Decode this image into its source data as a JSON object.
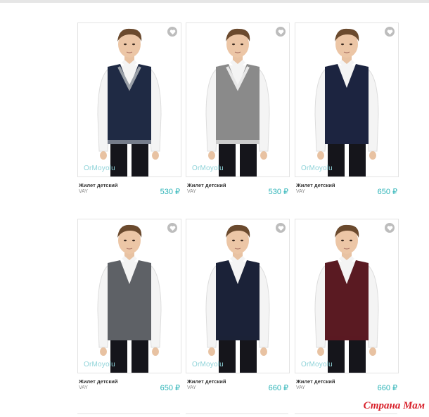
{
  "products": [
    {
      "name": "Жилет детский",
      "brand": "VAY",
      "price": "530 ₽",
      "watermark": "OrMoyolu",
      "vest_color": "#1f2a44",
      "trim_color": "#9aa0a8",
      "vneck_trim": true,
      "shirt": "#f4f4f4"
    },
    {
      "name": "Жилет детский",
      "brand": "VAY",
      "price": "530 ₽",
      "watermark": "OrMoyolu",
      "vest_color": "#8a8a8a",
      "trim_color": "#e8e8e8",
      "vneck_trim": true,
      "shirt": "#f4f4f4"
    },
    {
      "name": "Жилет детский",
      "brand": "VAY",
      "price": "650 ₽",
      "watermark": "OrMoyolu",
      "vest_color": "#1c2440",
      "trim_color": "#1c2440",
      "vneck_trim": false,
      "shirt": "#f4f4f4"
    },
    {
      "name": "Жилет детский",
      "brand": "VAY",
      "price": "650 ₽",
      "watermark": "OrMoyolu",
      "vest_color": "#5e6166",
      "trim_color": "#5e6166",
      "vneck_trim": false,
      "shirt": "#f4f4f4"
    },
    {
      "name": "Жилет детский",
      "brand": "VAY",
      "price": "660 ₽",
      "watermark": "OrMoyolu",
      "vest_color": "#1b2238",
      "trim_color": "#1b2238",
      "vneck_trim": false,
      "shirt": "#f4f4f4"
    },
    {
      "name": "Жилет детский",
      "brand": "VAY",
      "price": "660 ₽",
      "watermark": "OrMoyolu",
      "vest_color": "#5a1a22",
      "trim_color": "#5a1a22",
      "vneck_trim": false,
      "shirt": "#f4f4f4"
    }
  ],
  "site_logo": "Страна Мам",
  "colors": {
    "price": "#2bb3b7",
    "site_logo": "#d8202a",
    "favorite_icon_bg": "#bdbdbd"
  }
}
